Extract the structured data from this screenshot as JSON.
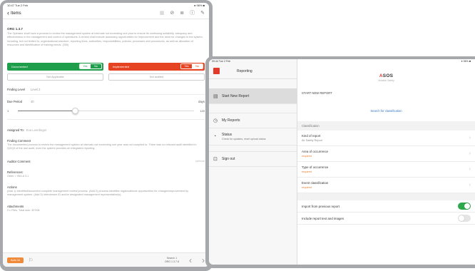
{
  "left": {
    "status_time": "10:47 Tue 2 Feb",
    "status_right": "● 96% ■",
    "nav": {
      "back_label": "Items"
    },
    "item": {
      "ref": "ORG 1.3.7",
      "text": "The Operator shall have a process to review the management system at intervals not exceeding one year to ensure its continuing suitability, adequacy and effectiveness in the management and control of operations. A review shall include assessing opportunities for improvement and the need for changes to the system, including, but not limited to, organizational structure, reporting lines, authorities, responsibilities, policies, processes and procedures, as well as allocation of resources and identification of training needs. (GM)"
    },
    "toggles": {
      "documented": {
        "label": "Documented",
        "yes": "Yes",
        "no": "No",
        "selected": "Yes"
      },
      "implemented": {
        "label": "Implemented",
        "yes": "Yes",
        "no": "No",
        "selected": "No"
      }
    },
    "buttons": {
      "not_applicable": "Not Applicable",
      "not_audited": "Not audited"
    },
    "finding_level": {
      "label": "Finding Level",
      "value": "Level 2"
    },
    "due_period": {
      "label": "Due Period",
      "value": "40",
      "unit": "days"
    },
    "slider": {
      "min": "1",
      "max": "120",
      "value": 40,
      "range_min": 1,
      "range_max": 120
    },
    "assigned_to": {
      "label": "Assigned To:",
      "value": "Eva Leerdinger"
    },
    "finding_comment": {
      "label": "Finding Comment",
      "text": "The documented process to review the management system at intervals not exceeding one year was not complied to. There was no relevant audit identified in Q2/Q3 of the last audit, even the system provides an integrated reporting."
    },
    "auditor_comment": {
      "label": "Auditor Comment",
      "optional": "optional"
    },
    "references": {
      "label": "References:",
      "text": "Other > ISM.A 3.1"
    },
    "actions": {
      "label": "Actions",
      "text": "(Add 1) Identified/document complete management review process. (Add 2) process identifies organizational opportunities for changes/improvement by management system. (Add 3) Interviewee ID and/or designated management representative(s)."
    },
    "attachments": {
      "label": "Attachments",
      "text": "2 x Files, Total size: 307KB"
    },
    "bottom": {
      "auto_label": "Auto 1h",
      "search_line1": "Search 1",
      "search_line2": "ORG 1.3.7.8"
    }
  },
  "right": {
    "side": {
      "status_time": "09:44 Tue 2 Feb",
      "title": "Reporting",
      "items": [
        {
          "label": "Start New Report",
          "icon": "document-icon"
        },
        {
          "label": "My Reports",
          "icon": "clock-icon"
        },
        {
          "label": "Status",
          "sub": "Check for updates, reset upload status",
          "icon": "status-icon"
        },
        {
          "label": "Sign out",
          "icon": "lock-icon"
        }
      ]
    },
    "main": {
      "status_right": "● 96% ■",
      "brand": {
        "name_a": "A",
        "name_rest": "SOS",
        "sub": "Aviation Safety"
      },
      "start_new_report": "START NEW REPORT",
      "search_link": "Search for classification",
      "classification_header": "Classification",
      "fields": [
        {
          "title": "Kind of report",
          "value": "Air Safety Report",
          "required": false
        },
        {
          "title": "Area of occurrence",
          "value": "required",
          "required": true
        },
        {
          "title": "Type of occurrence",
          "value": "required",
          "required": true
        },
        {
          "title": "Event classification",
          "value": "required",
          "required": true
        }
      ],
      "switches": [
        {
          "label": "Import from previous report",
          "on": true
        },
        {
          "label": "Include report text and images",
          "on": false
        }
      ]
    }
  },
  "colors": {
    "green": "#1e9e4a",
    "red": "#e64322",
    "orange": "#f08a3b",
    "link": "#3a78c2",
    "switch_on": "#2ea84c",
    "logo_red": "#e23b2c"
  }
}
